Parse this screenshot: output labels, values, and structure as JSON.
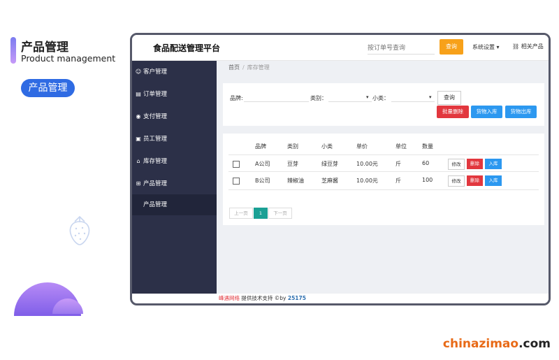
{
  "promo": {
    "title": "产品管理",
    "subtitle": "Product management",
    "pill": "产品管理"
  },
  "watermark": {
    "brand": "chinazimao",
    "tld": ".com"
  },
  "app": {
    "title": "食品配送管理平台",
    "order_search_placeholder": "按订单号查询",
    "query_button": "查询",
    "system_settings": "系统设置 ▾",
    "related_products": "相关产品"
  },
  "sidebar": {
    "items": [
      {
        "label": "客户管理",
        "icon": "user-icon"
      },
      {
        "label": "订单管理",
        "icon": "document-icon"
      },
      {
        "label": "支付管理",
        "icon": "payment-icon"
      },
      {
        "label": "员工管理",
        "icon": "id-card-icon"
      },
      {
        "label": "库存管理",
        "icon": "home-icon"
      },
      {
        "label": "产品管理",
        "icon": "grid-icon"
      }
    ],
    "subitem": "产品管理"
  },
  "breadcrumb": {
    "home": "首页",
    "separator": "/",
    "current": "库存管理"
  },
  "filter": {
    "brand_label": "品牌:",
    "category_label": "类别：",
    "subcategory_label": "小类：",
    "query_button": "查询",
    "batch_delete": "批量删除",
    "stock_in": "货物入库",
    "stock_out": "货物出库"
  },
  "table": {
    "headers": [
      "品牌",
      "类别",
      "小类",
      "单价",
      "单位",
      "数量"
    ],
    "rows": [
      {
        "brand": "A公司",
        "category": "豆芽",
        "subcategory": "绿豆芽",
        "price": "10.00元",
        "unit": "斤",
        "qty": "60"
      },
      {
        "brand": "B公司",
        "category": "辣椒油",
        "subcategory": "芝麻酱",
        "price": "10.00元",
        "unit": "斤",
        "qty": "100"
      }
    ],
    "actions": {
      "edit": "修改",
      "delete": "删除",
      "stock_in": "入库"
    }
  },
  "pager": {
    "prev": "上一页",
    "current": "1",
    "next": "下一页"
  },
  "footer": {
    "brand": "峰遇网络",
    "text": " 提供技术支持 ©by ",
    "number": "25175"
  },
  "colors": {
    "sidebar": "#2c3048",
    "primary": "#2c98f0",
    "danger": "#e2373e",
    "warning": "#f7a11a",
    "page_active": "#1aa094"
  }
}
